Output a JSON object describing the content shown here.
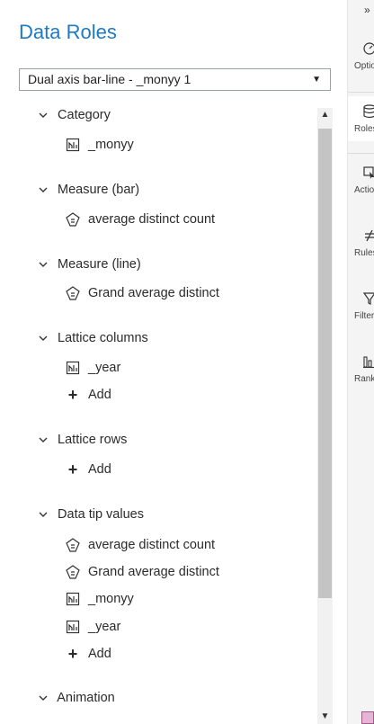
{
  "panel": {
    "title": "Data Roles"
  },
  "dropdown": {
    "value": "Dual axis bar-line - _monyy 1"
  },
  "sections": {
    "category": {
      "label": "Category",
      "items": [
        "_monyy"
      ]
    },
    "measure_bar": {
      "label": "Measure (bar)",
      "items": [
        "average distinct count"
      ]
    },
    "measure_line": {
      "label": "Measure (line)",
      "items": [
        "Grand average distinct"
      ]
    },
    "lattice_columns": {
      "label": "Lattice columns",
      "items": [
        "_year"
      ],
      "add": "Add"
    },
    "lattice_rows": {
      "label": "Lattice rows",
      "add": "Add"
    },
    "data_tip": {
      "label": "Data tip values",
      "items": [
        "average distinct count",
        "Grand average distinct",
        "_monyy",
        "_year"
      ],
      "add": "Add"
    },
    "animation": {
      "label": "Animation"
    }
  },
  "rail": {
    "items": [
      {
        "label": "Options",
        "icon": "gauge-icon"
      },
      {
        "label": "Roles",
        "icon": "database-icon"
      },
      {
        "label": "Actions",
        "icon": "cursor-box-icon"
      },
      {
        "label": "Rules",
        "icon": "not-equal-icon"
      },
      {
        "label": "Filters",
        "icon": "funnel-icon"
      },
      {
        "label": "Ranks",
        "icon": "bar-chart-icon"
      }
    ]
  },
  "colors": {
    "title": "#1f7ac4",
    "text": "#2b2b2b",
    "rail_bg": "#f4f4f4"
  }
}
